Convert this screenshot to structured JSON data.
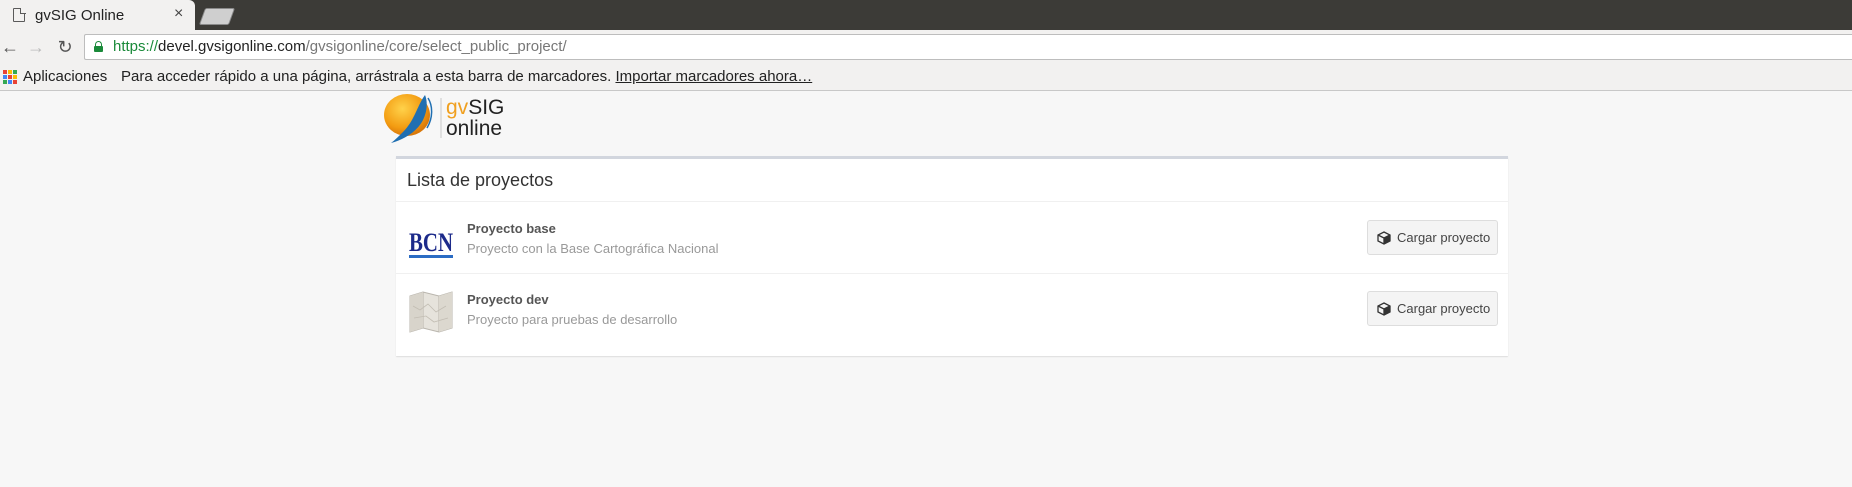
{
  "browser": {
    "tab_title": "gvSIG Online",
    "tab_close": "×",
    "url_scheme": "https://",
    "url_host": "devel.gvsigonline.com",
    "url_path": "/gvsigonline/core/select_public_project/",
    "bookmarks": {
      "apps_label": "Aplicaciones",
      "hint": "Para acceder rápido a una página, arrástrala a esta barra de marcadores.",
      "import_link": "Importar marcadores ahora…"
    },
    "nav": {
      "back": "←",
      "forward": "→",
      "reload": "↻"
    }
  },
  "logo": {
    "gv": "gv",
    "sig": "SIG",
    "online": "online"
  },
  "panel": {
    "title": "Lista de proyectos",
    "projects": [
      {
        "name": "Proyecto base",
        "description": "Proyecto con la Base Cartográfica Nacional",
        "button": "Cargar proyecto",
        "thumb_text": "BCN"
      },
      {
        "name": "Proyecto dev",
        "description": "Proyecto para pruebas de desarrollo",
        "button": "Cargar proyecto"
      }
    ]
  },
  "colors": {
    "accent_green": "#1a8a3a",
    "panel_border": "#d2d6de",
    "logo_orange": "#f0a020"
  }
}
